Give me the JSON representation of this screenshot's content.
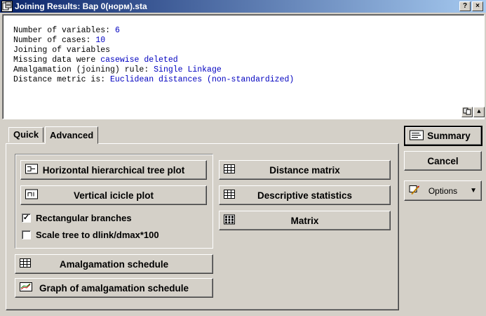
{
  "window": {
    "title": "Joining Results: Вар 0(норм).sta",
    "help_label": "?",
    "close_label": "×"
  },
  "output": {
    "lines": [
      {
        "label": "Number of variables: ",
        "value": "6"
      },
      {
        "label": "Number of cases: ",
        "value": "10"
      },
      {
        "label": "Joining of variables",
        "value": ""
      },
      {
        "label": "Missing data were ",
        "value": "casewise deleted"
      },
      {
        "label": "Amalgamation (joining) rule: ",
        "value": "Single Linkage"
      },
      {
        "label": "Distance metric is: ",
        "value": "Euclidean distances (non-standardized)"
      }
    ],
    "scroll_up_label": "▲"
  },
  "tabs": [
    {
      "label": "Quick",
      "active": false
    },
    {
      "label": "Advanced",
      "active": true
    }
  ],
  "advanced": {
    "horizontal_tree_plot": "Horizontal hierarchical tree plot",
    "vertical_icicle_plot": "Vertical icicle plot",
    "rectangular_branches": {
      "label": "Rectangular branches",
      "checked": true,
      "mark": "✓"
    },
    "scale_tree": {
      "label": "Scale tree to dlink/dmax*100",
      "checked": false
    },
    "amalgamation_schedule": "Amalgamation schedule",
    "graph_amalgamation_schedule": "Graph of amalgamation schedule",
    "distance_matrix": "Distance matrix",
    "descriptive_statistics": "Descriptive statistics",
    "matrix": "Matrix"
  },
  "side": {
    "summary": "Summary",
    "cancel": "Cancel",
    "options": "Options",
    "options_arrow": "▼"
  },
  "colors": {
    "title_start": "#0a246a",
    "title_end": "#a6caf0",
    "face": "#d4d0c8",
    "value_blue": "#0000c0"
  }
}
